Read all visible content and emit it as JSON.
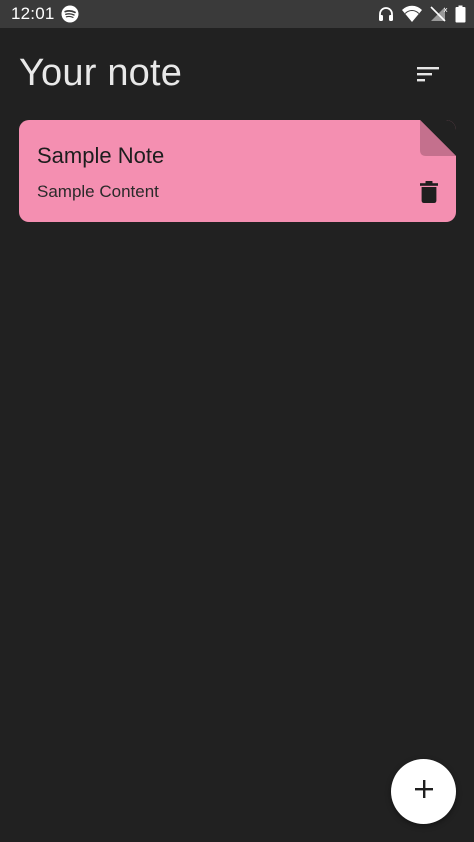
{
  "status_bar": {
    "time": "12:01",
    "left_icons": [
      "spotify-icon"
    ],
    "right_icons": [
      "headphones-icon",
      "wifi-icon",
      "no-signal-icon",
      "battery-icon"
    ]
  },
  "header": {
    "title": "Your note",
    "sort_icon": "sort-icon"
  },
  "notes": [
    {
      "title": "Sample Note",
      "content": "Sample Content",
      "color": "#f48fb1",
      "delete_icon": "trash-icon"
    }
  ],
  "fab": {
    "icon": "plus-icon"
  },
  "colors": {
    "background": "#212121",
    "status_bar": "#3a3a3a",
    "note_pink": "#f48fb1",
    "fab": "#ffffff"
  }
}
